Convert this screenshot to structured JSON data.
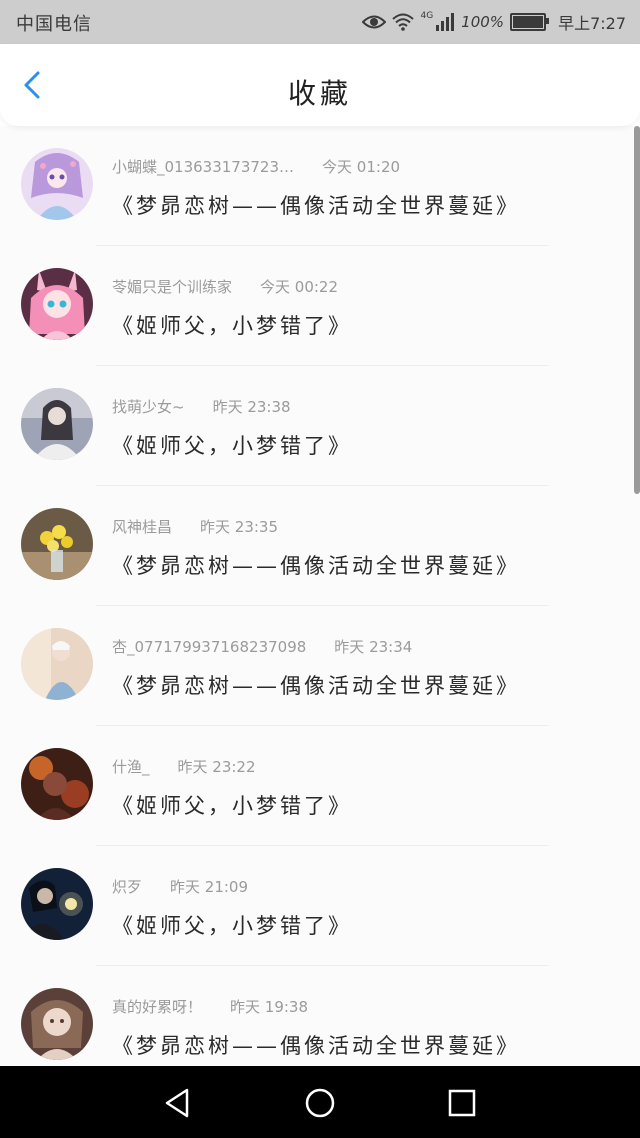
{
  "status_bar": {
    "carrier": "中国电信",
    "network": "4G",
    "battery": "100%",
    "time": "早上7:27"
  },
  "header": {
    "title": "收藏",
    "back_icon": "chevron-left-icon",
    "accent_color": "#2b8ff0"
  },
  "items": [
    {
      "author": "小蝴蝶_013633173723…",
      "time": "今天 01:20",
      "title": "《梦昴恋树——偶像活动全世界蔓延》"
    },
    {
      "author": "苓媚只是个训练家",
      "time": "今天 00:22",
      "title": "《姬师父，小梦错了》"
    },
    {
      "author": "找萌少女~",
      "time": "昨天 23:38",
      "title": "《姬师父，小梦错了》"
    },
    {
      "author": "风神桂昌",
      "time": "昨天 23:35",
      "title": "《梦昴恋树——偶像活动全世界蔓延》"
    },
    {
      "author": "杏_077179937168237098",
      "time": "昨天 23:34",
      "title": "《梦昴恋树——偶像活动全世界蔓延》"
    },
    {
      "author": "什渔_",
      "time": "昨天 23:22",
      "title": "《姬师父，小梦错了》"
    },
    {
      "author": "炽歹",
      "time": "昨天 21:09",
      "title": "《姬师父，小梦错了》"
    },
    {
      "author": "真的好累呀！",
      "time": "昨天 19:38",
      "title": "《梦昴恋树——偶像活动全世界蔓延》"
    }
  ],
  "nav": {
    "back_icon": "triangle-back-icon",
    "home_icon": "circle-home-icon",
    "recents_icon": "square-recents-icon"
  }
}
